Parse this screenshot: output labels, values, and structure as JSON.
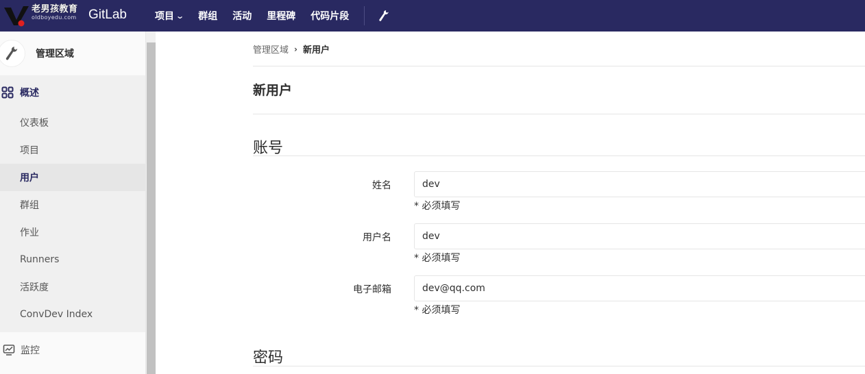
{
  "header": {
    "brand": "GitLab",
    "watermark_text": "老男孩教育",
    "watermark_url": "oldboyedu.com",
    "nav": [
      {
        "label": "项目",
        "dropdown": true
      },
      {
        "label": "群组"
      },
      {
        "label": "活动"
      },
      {
        "label": "里程碑"
      },
      {
        "label": "代码片段"
      }
    ],
    "admin_icon": "wrench-icon"
  },
  "sidebar": {
    "title": "管理区域",
    "group": {
      "label": "概述",
      "icon": "grid-icon",
      "items": [
        {
          "label": "仪表板"
        },
        {
          "label": "项目"
        },
        {
          "label": "用户",
          "active": true
        },
        {
          "label": "群组"
        },
        {
          "label": "作业"
        },
        {
          "label": "Runners"
        },
        {
          "label": "活跃度"
        },
        {
          "label": "ConvDev Index"
        }
      ]
    },
    "monitoring": {
      "label": "监控",
      "icon": "monitor-chart-icon"
    }
  },
  "breadcrumb": {
    "parent": "管理区域",
    "current": "新用户"
  },
  "page_title": "新用户",
  "sections": {
    "account": "账号",
    "password": "密码"
  },
  "form": {
    "name": {
      "label": "姓名",
      "value": "dev",
      "hint": "* 必须填写"
    },
    "username": {
      "label": "用户名",
      "value": "dev",
      "hint": "* 必须填写"
    },
    "email": {
      "label": "电子邮箱",
      "value": "dev@qq.com",
      "hint": "* 必须填写"
    }
  },
  "colors": {
    "navbar": "#292961",
    "sidebar_active_text": "#292961",
    "sidebar_bg": "#fafafa"
  }
}
